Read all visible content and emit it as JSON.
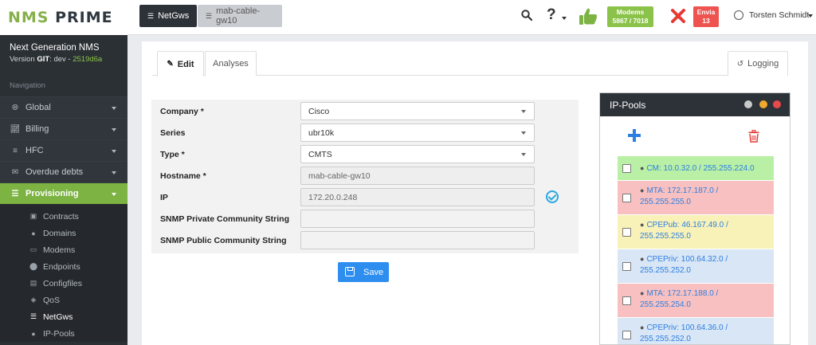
{
  "app": {
    "logo_nms": "NMS",
    "logo_prime": "PRIME",
    "brand_title": "Next Generation NMS",
    "brand_version_prefix": "Version",
    "brand_git_label": "GIT",
    "brand_git_branch": ": dev -",
    "brand_git_hash": "2519d6a"
  },
  "sidebar": {
    "heading": "Navigation",
    "items": [
      {
        "label": "Global",
        "icon": "globe-icon",
        "glyph": "🌐︎"
      },
      {
        "label": "Billing",
        "icon": "chart-icon",
        "glyph": "📈︎"
      },
      {
        "label": "HFC",
        "icon": "sliders-icon",
        "glyph": "≡"
      },
      {
        "label": "Overdue debts",
        "icon": "envelope-icon",
        "glyph": "✉"
      },
      {
        "label": "Provisioning",
        "icon": "database-icon",
        "glyph": "☰"
      }
    ],
    "subitems": [
      {
        "label": "Contracts",
        "icon": "contract-icon",
        "glyph": "▣"
      },
      {
        "label": "Domains",
        "icon": "tag-icon",
        "glyph": "●"
      },
      {
        "label": "Modems",
        "icon": "modem-icon",
        "glyph": "▭"
      },
      {
        "label": "Endpoints",
        "icon": "map-marker-icon",
        "glyph": "⬤"
      },
      {
        "label": "Configfiles",
        "icon": "file-icon",
        "glyph": "▤"
      },
      {
        "label": "QoS",
        "icon": "ticket-icon",
        "glyph": "◈"
      },
      {
        "label": "NetGws",
        "icon": "server-icon",
        "glyph": "☰"
      },
      {
        "label": "IP-Pools",
        "icon": "tags-icon",
        "glyph": "●"
      }
    ]
  },
  "topbar": {
    "crumb_netgws": "NetGws",
    "crumb_gw": "mab-cable-gw10",
    "help_label": "?",
    "modems_label": "Modems",
    "modems_count": "5867 / 7018",
    "envia_label": "Envia",
    "envia_count": "13",
    "user_name": "Torsten Schmidt"
  },
  "tabs": {
    "edit": "Edit",
    "analyses": "Analyses",
    "logging": "Logging"
  },
  "form": {
    "company_label": "Company *",
    "company_value": "Cisco",
    "series_label": "Series",
    "series_value": "ubr10k",
    "type_label": "Type *",
    "type_value": "CMTS",
    "hostname_label": "Hostname *",
    "hostname_value": "mab-cable-gw10",
    "ip_label": "IP",
    "ip_value": "172.20.0.248",
    "snmp_private_label": "SNMP Private Community String",
    "snmp_private_value": "",
    "snmp_public_label": "SNMP Public Community String",
    "snmp_public_value": "",
    "save_label": "Save"
  },
  "ippools": {
    "title": "IP-Pools",
    "pools": [
      {
        "text": "CM: 10.0.32.0 / 255.255.224.0",
        "color": "#b9f0a6"
      },
      {
        "text": "MTA: 172.17.187.0 / 255.255.255.0",
        "color": "#f8c0c0"
      },
      {
        "text": "CPEPub: 46.167.49.0 / 255.255.255.0",
        "color": "#f8f2b8"
      },
      {
        "text": "CPEPriv: 100.64.32.0 / 255.255.252.0",
        "color": "#d8e6f6"
      },
      {
        "text": "MTA: 172.17.188.0 / 255.255.254.0",
        "color": "#f8c0c0"
      },
      {
        "text": "CPEPriv: 100.64.36.0 / 255.255.252.0",
        "color": "#d8e6f6"
      }
    ]
  }
}
